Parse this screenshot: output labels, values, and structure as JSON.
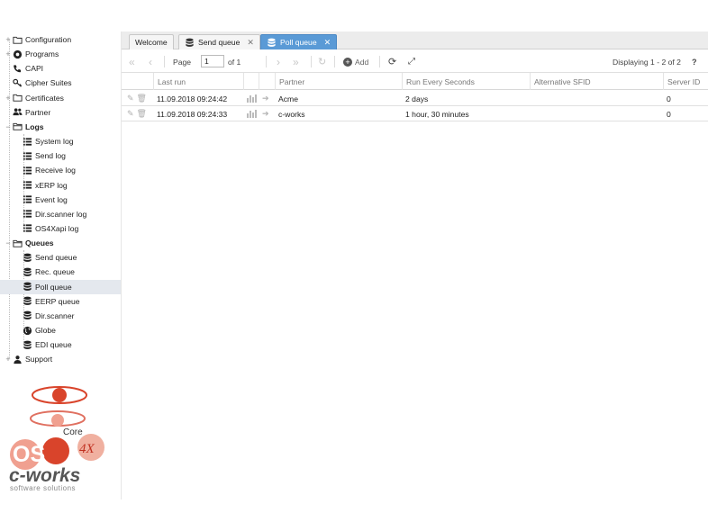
{
  "sidebar": {
    "items": [
      {
        "label": "Configuration",
        "icon": "folder-icon",
        "expander": "+"
      },
      {
        "label": "Programs",
        "icon": "dashboard-icon",
        "expander": "+"
      },
      {
        "label": "CAPI",
        "icon": "phone-icon",
        "expander": ""
      },
      {
        "label": "Cipher Suites",
        "icon": "key-icon",
        "expander": ""
      },
      {
        "label": "Certificates",
        "icon": "folder-icon",
        "expander": "+"
      },
      {
        "label": "Partner",
        "icon": "users-icon",
        "expander": ""
      },
      {
        "label": "Logs",
        "icon": "folder-open-icon",
        "expander": "−"
      },
      {
        "label": "System log",
        "icon": "list-icon"
      },
      {
        "label": "Send log",
        "icon": "list-icon"
      },
      {
        "label": "Receive log",
        "icon": "list-icon"
      },
      {
        "label": "xERP log",
        "icon": "list-icon"
      },
      {
        "label": "Event log",
        "icon": "list-icon"
      },
      {
        "label": "Dir.scanner log",
        "icon": "list-icon"
      },
      {
        "label": "OS4Xapi log",
        "icon": "list-icon"
      },
      {
        "label": "Queues",
        "icon": "folder-open-icon",
        "expander": "−"
      },
      {
        "label": "Send queue",
        "icon": "database-icon"
      },
      {
        "label": "Rec. queue",
        "icon": "database-icon"
      },
      {
        "label": "Poll queue",
        "icon": "database-icon"
      },
      {
        "label": "EERP queue",
        "icon": "database-icon"
      },
      {
        "label": "Dir.scanner",
        "icon": "database-icon"
      },
      {
        "label": "Globe",
        "icon": "globe-icon"
      },
      {
        "label": "EDI queue",
        "icon": "database-icon"
      },
      {
        "label": "Support",
        "icon": "user-icon",
        "expander": "+"
      }
    ]
  },
  "logo": {
    "core_text": "Core",
    "brand_os": "OS",
    "brand_4x": "4X",
    "brand_name": "c-works",
    "tagline": "software solutions",
    "colors": {
      "red": "#d9442b",
      "light": "#f0a090"
    }
  },
  "tabs": [
    {
      "label": "Welcome",
      "icon": ""
    },
    {
      "label": "Send queue",
      "icon": "database-icon"
    },
    {
      "label": "Poll queue",
      "icon": "database-icon"
    }
  ],
  "toolbar": {
    "page_label": "Page",
    "page_value": "1",
    "of_label": "of 1",
    "add_label": "Add",
    "displaying": "Displaying 1 - 2 of 2",
    "help": "?"
  },
  "grid": {
    "columns": [
      "",
      "",
      "Last run",
      "",
      "",
      "Partner",
      "Run Every Seconds",
      "Alternative SFID",
      "Server ID"
    ],
    "rows": [
      {
        "last_run": "11.09.2018 09:24:42",
        "partner": "Acme",
        "run_every": "2 days",
        "alt_sfid": "",
        "server_id": "0"
      },
      {
        "last_run": "11.09.2018 09:24:33",
        "partner": "c-works",
        "run_every": "1 hour, 30 minutes",
        "alt_sfid": "",
        "server_id": "0"
      }
    ]
  },
  "colors": {
    "accent": "#5a9ad6",
    "selected_row": "#e4e8ee"
  }
}
